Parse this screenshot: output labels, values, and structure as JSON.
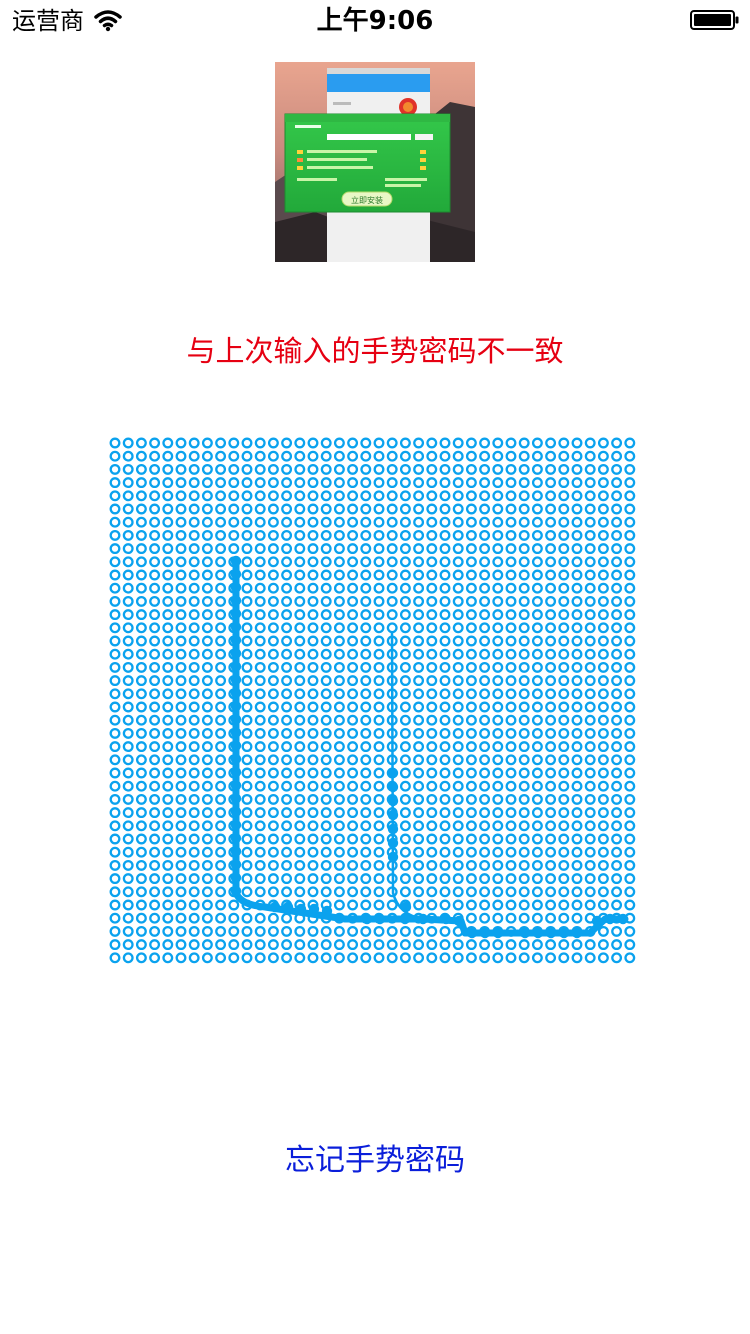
{
  "status_bar": {
    "carrier": "运营商",
    "time": "上午9:06"
  },
  "thumbnail": {
    "popup_button_label": "立即安装"
  },
  "gesture": {
    "error_message": "与上次输入的手势密码不一致",
    "forgot_label": "忘记手势密码",
    "grid_rows": 40,
    "grid_cols": 40,
    "dot_color": "#0aa2ee",
    "line_color": "#0aa2ee",
    "error_color": "#e60012",
    "link_color": "#0a1eda"
  }
}
